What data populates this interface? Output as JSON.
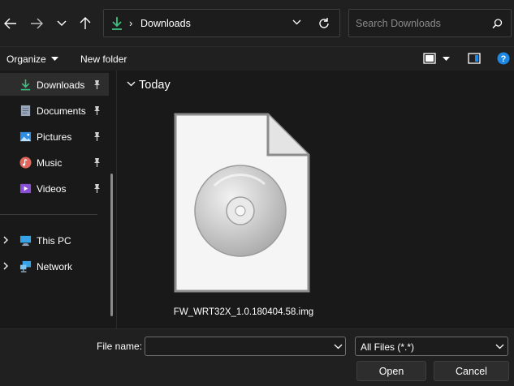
{
  "address": {
    "current_folder": "Downloads",
    "separator": "›"
  },
  "search": {
    "placeholder": "Search Downloads"
  },
  "commandbar": {
    "organize_label": "Organize",
    "new_folder_label": "New folder"
  },
  "navpane": {
    "quick_access": [
      {
        "label": "Downloads",
        "icon": "download-arrow-icon",
        "pinned": true,
        "selected": true
      },
      {
        "label": "Documents",
        "icon": "documents-icon",
        "pinned": true
      },
      {
        "label": "Pictures",
        "icon": "pictures-icon",
        "pinned": true
      },
      {
        "label": "Music",
        "icon": "music-icon",
        "pinned": true
      },
      {
        "label": "Videos",
        "icon": "videos-icon",
        "pinned": true
      }
    ],
    "locations": [
      {
        "label": "This PC",
        "icon": "this-pc-icon"
      },
      {
        "label": "Network",
        "icon": "network-icon"
      }
    ]
  },
  "content": {
    "group_label": "Today",
    "files": [
      {
        "name": "FW_WRT32X_1.0.180404.58.img",
        "icon": "disc-image-file-icon"
      }
    ]
  },
  "footer": {
    "file_name_label": "File name:",
    "file_name_value": "",
    "filter_value": "All Files (*.*)",
    "open_label": "Open",
    "cancel_label": "Cancel"
  },
  "colors": {
    "accent_green": "#3fbf7f",
    "help_blue": "#1e88e5",
    "background": "#191919"
  }
}
